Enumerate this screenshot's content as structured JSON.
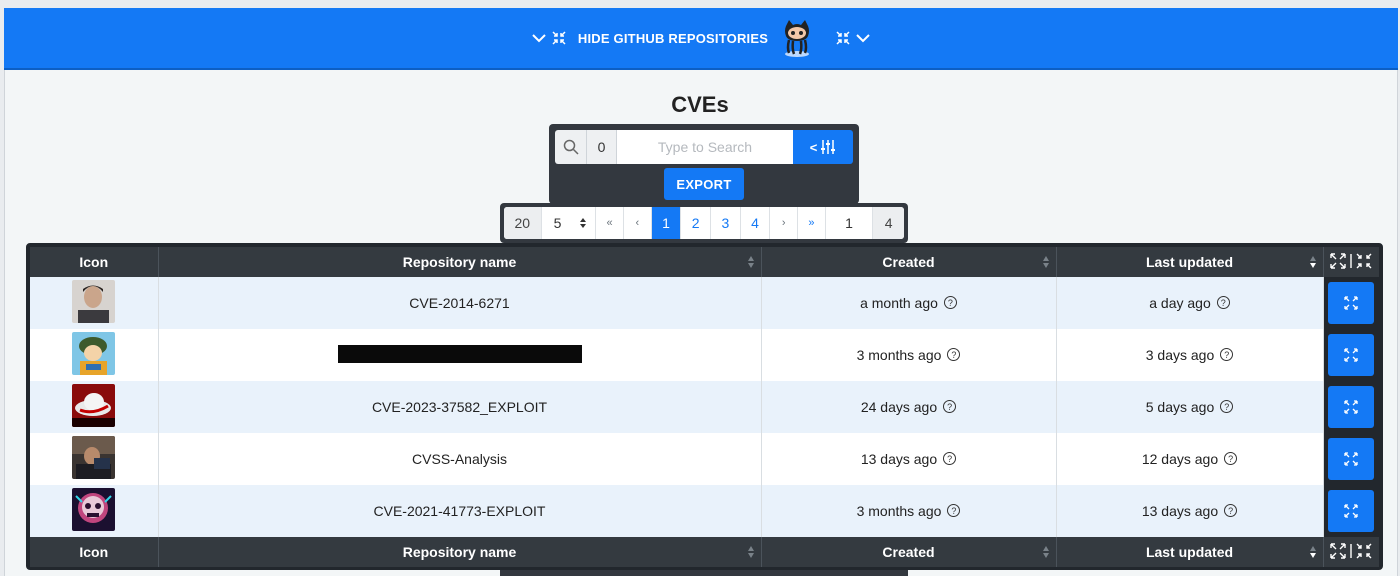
{
  "banner": {
    "text": "HIDE GITHUB REPOSITORIES"
  },
  "page_title": "CVEs",
  "search": {
    "count": "0",
    "placeholder": "Type to Search",
    "filter_label": "<"
  },
  "export_label": "EXPORT",
  "pagination": {
    "per_page": "20",
    "page_size": "5",
    "first": "«",
    "prev": "‹",
    "pages": [
      "1",
      "2",
      "3",
      "4"
    ],
    "active_page": "1",
    "next": "›",
    "last": "»",
    "current_input": "1",
    "total_pages": "4"
  },
  "table": {
    "headers": [
      "Icon",
      "Repository name",
      "Created",
      "Last updated"
    ],
    "rows": [
      {
        "name": "CVE-2014-6271",
        "created": "a month ago",
        "updated": "a day ago",
        "redacted": false
      },
      {
        "name": "",
        "created": "3 months ago",
        "updated": "3 days ago",
        "redacted": true
      },
      {
        "name": "CVE-2023-37582_EXPLOIT",
        "created": "24 days ago",
        "updated": "5 days ago",
        "redacted": false
      },
      {
        "name": "CVSS-Analysis",
        "created": "13 days ago",
        "updated": "12 days ago",
        "redacted": false
      },
      {
        "name": "CVE-2021-41773-EXPLOIT",
        "created": "3 months ago",
        "updated": "13 days ago",
        "redacted": false
      }
    ]
  },
  "help_glyph": "?",
  "colors": {
    "primary": "#1479f5",
    "dark": "#343a40",
    "row_alt": "#e9f2fb"
  }
}
